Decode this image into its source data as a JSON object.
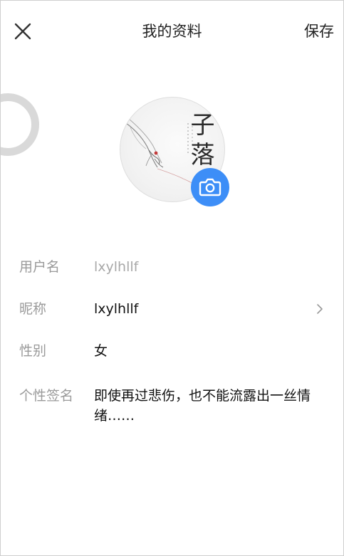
{
  "header": {
    "close_icon": "close-icon",
    "title": "我的资料",
    "save_label": "保存"
  },
  "avatar": {
    "calligraphy_text": "子落",
    "camera_icon": "camera-icon",
    "accent": "#3d8ef7"
  },
  "profile": {
    "username": {
      "label": "用户名",
      "value": "lxylhllf"
    },
    "nickname": {
      "label": "昵称",
      "value": "lxylhllf",
      "icon": "chevron-right-icon"
    },
    "gender": {
      "label": "性别",
      "value": "女"
    },
    "signature": {
      "label": "个性签名",
      "value": "即使再过悲伤，也不能流露出一丝情绪……"
    }
  }
}
